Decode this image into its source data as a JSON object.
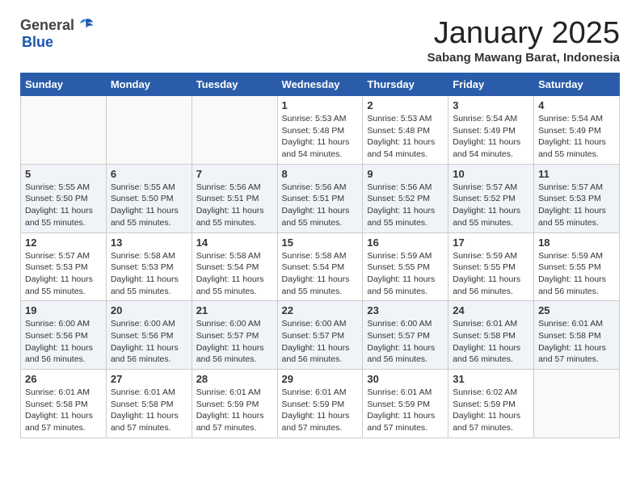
{
  "header": {
    "logo_general": "General",
    "logo_blue": "Blue",
    "month_title": "January 2025",
    "location": "Sabang Mawang Barat, Indonesia"
  },
  "weekdays": [
    "Sunday",
    "Monday",
    "Tuesday",
    "Wednesday",
    "Thursday",
    "Friday",
    "Saturday"
  ],
  "weeks": [
    [
      {
        "day": "",
        "info": ""
      },
      {
        "day": "",
        "info": ""
      },
      {
        "day": "",
        "info": ""
      },
      {
        "day": "1",
        "info": "Sunrise: 5:53 AM\nSunset: 5:48 PM\nDaylight: 11 hours\nand 54 minutes."
      },
      {
        "day": "2",
        "info": "Sunrise: 5:53 AM\nSunset: 5:48 PM\nDaylight: 11 hours\nand 54 minutes."
      },
      {
        "day": "3",
        "info": "Sunrise: 5:54 AM\nSunset: 5:49 PM\nDaylight: 11 hours\nand 54 minutes."
      },
      {
        "day": "4",
        "info": "Sunrise: 5:54 AM\nSunset: 5:49 PM\nDaylight: 11 hours\nand 55 minutes."
      }
    ],
    [
      {
        "day": "5",
        "info": "Sunrise: 5:55 AM\nSunset: 5:50 PM\nDaylight: 11 hours\nand 55 minutes."
      },
      {
        "day": "6",
        "info": "Sunrise: 5:55 AM\nSunset: 5:50 PM\nDaylight: 11 hours\nand 55 minutes."
      },
      {
        "day": "7",
        "info": "Sunrise: 5:56 AM\nSunset: 5:51 PM\nDaylight: 11 hours\nand 55 minutes."
      },
      {
        "day": "8",
        "info": "Sunrise: 5:56 AM\nSunset: 5:51 PM\nDaylight: 11 hours\nand 55 minutes."
      },
      {
        "day": "9",
        "info": "Sunrise: 5:56 AM\nSunset: 5:52 PM\nDaylight: 11 hours\nand 55 minutes."
      },
      {
        "day": "10",
        "info": "Sunrise: 5:57 AM\nSunset: 5:52 PM\nDaylight: 11 hours\nand 55 minutes."
      },
      {
        "day": "11",
        "info": "Sunrise: 5:57 AM\nSunset: 5:53 PM\nDaylight: 11 hours\nand 55 minutes."
      }
    ],
    [
      {
        "day": "12",
        "info": "Sunrise: 5:57 AM\nSunset: 5:53 PM\nDaylight: 11 hours\nand 55 minutes."
      },
      {
        "day": "13",
        "info": "Sunrise: 5:58 AM\nSunset: 5:53 PM\nDaylight: 11 hours\nand 55 minutes."
      },
      {
        "day": "14",
        "info": "Sunrise: 5:58 AM\nSunset: 5:54 PM\nDaylight: 11 hours\nand 55 minutes."
      },
      {
        "day": "15",
        "info": "Sunrise: 5:58 AM\nSunset: 5:54 PM\nDaylight: 11 hours\nand 55 minutes."
      },
      {
        "day": "16",
        "info": "Sunrise: 5:59 AM\nSunset: 5:55 PM\nDaylight: 11 hours\nand 56 minutes."
      },
      {
        "day": "17",
        "info": "Sunrise: 5:59 AM\nSunset: 5:55 PM\nDaylight: 11 hours\nand 56 minutes."
      },
      {
        "day": "18",
        "info": "Sunrise: 5:59 AM\nSunset: 5:55 PM\nDaylight: 11 hours\nand 56 minutes."
      }
    ],
    [
      {
        "day": "19",
        "info": "Sunrise: 6:00 AM\nSunset: 5:56 PM\nDaylight: 11 hours\nand 56 minutes."
      },
      {
        "day": "20",
        "info": "Sunrise: 6:00 AM\nSunset: 5:56 PM\nDaylight: 11 hours\nand 56 minutes."
      },
      {
        "day": "21",
        "info": "Sunrise: 6:00 AM\nSunset: 5:57 PM\nDaylight: 11 hours\nand 56 minutes."
      },
      {
        "day": "22",
        "info": "Sunrise: 6:00 AM\nSunset: 5:57 PM\nDaylight: 11 hours\nand 56 minutes."
      },
      {
        "day": "23",
        "info": "Sunrise: 6:00 AM\nSunset: 5:57 PM\nDaylight: 11 hours\nand 56 minutes."
      },
      {
        "day": "24",
        "info": "Sunrise: 6:01 AM\nSunset: 5:58 PM\nDaylight: 11 hours\nand 56 minutes."
      },
      {
        "day": "25",
        "info": "Sunrise: 6:01 AM\nSunset: 5:58 PM\nDaylight: 11 hours\nand 57 minutes."
      }
    ],
    [
      {
        "day": "26",
        "info": "Sunrise: 6:01 AM\nSunset: 5:58 PM\nDaylight: 11 hours\nand 57 minutes."
      },
      {
        "day": "27",
        "info": "Sunrise: 6:01 AM\nSunset: 5:58 PM\nDaylight: 11 hours\nand 57 minutes."
      },
      {
        "day": "28",
        "info": "Sunrise: 6:01 AM\nSunset: 5:59 PM\nDaylight: 11 hours\nand 57 minutes."
      },
      {
        "day": "29",
        "info": "Sunrise: 6:01 AM\nSunset: 5:59 PM\nDaylight: 11 hours\nand 57 minutes."
      },
      {
        "day": "30",
        "info": "Sunrise: 6:01 AM\nSunset: 5:59 PM\nDaylight: 11 hours\nand 57 minutes."
      },
      {
        "day": "31",
        "info": "Sunrise: 6:02 AM\nSunset: 5:59 PM\nDaylight: 11 hours\nand 57 minutes."
      },
      {
        "day": "",
        "info": ""
      }
    ]
  ]
}
